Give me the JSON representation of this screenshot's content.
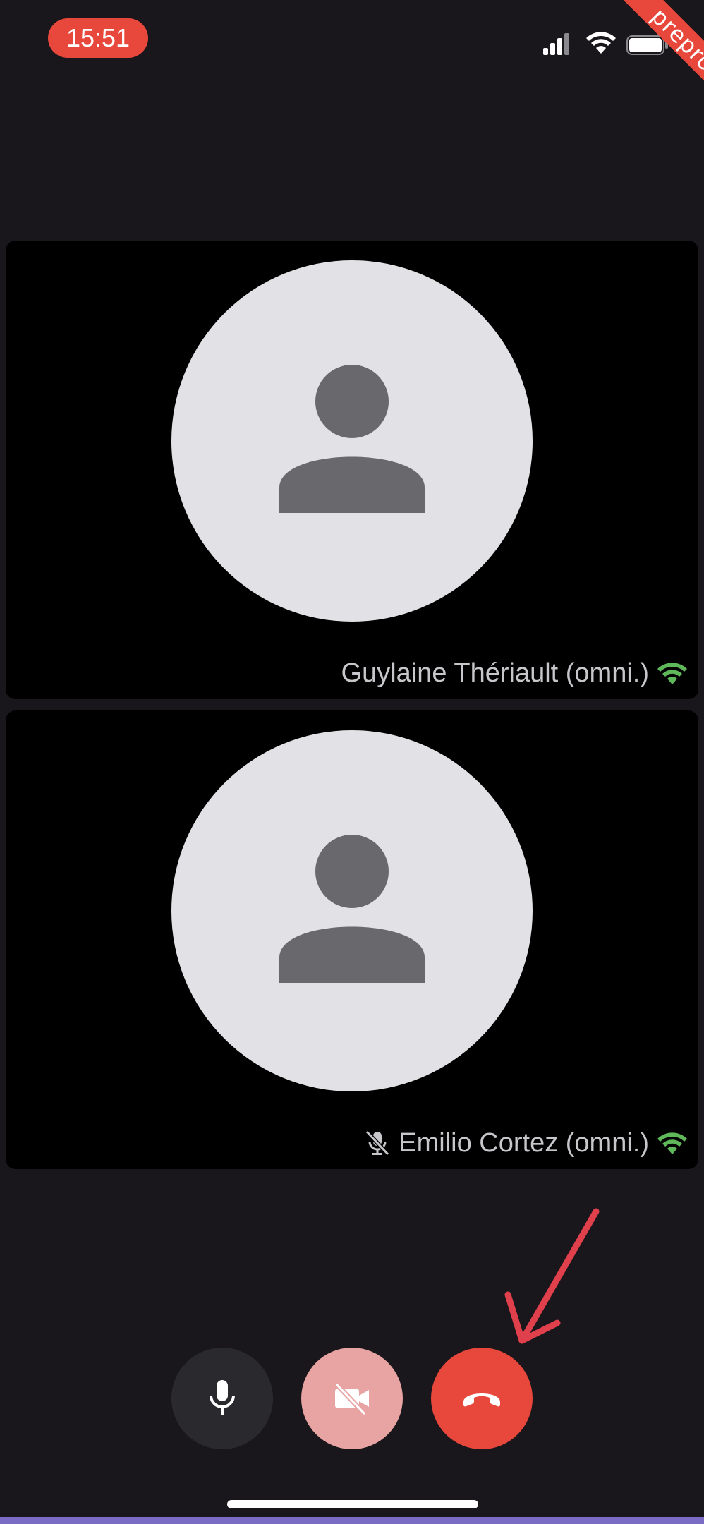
{
  "status_bar": {
    "time": "15:51",
    "icons": [
      "cellular-signal-icon",
      "wifi-icon",
      "battery-icon"
    ],
    "env_ribbon": "preprod"
  },
  "participants": [
    {
      "name": "Guylaine Thériault (omni.)",
      "muted": false,
      "network_quality": "good"
    },
    {
      "name": "Emilio Cortez (omni.)",
      "muted": true,
      "network_quality": "good"
    }
  ],
  "controls": {
    "microphone": {
      "icon": "microphone-icon",
      "state": "on"
    },
    "camera": {
      "icon": "camera-off-icon",
      "state": "off"
    },
    "hang_up": {
      "icon": "phone-hangup-icon"
    }
  },
  "colors": {
    "background": "#19171b",
    "accent_red": "#e8473c",
    "network_green": "#5fb85a",
    "avatar_bg": "#e2e1e5",
    "avatar_fg": "#69686d"
  }
}
